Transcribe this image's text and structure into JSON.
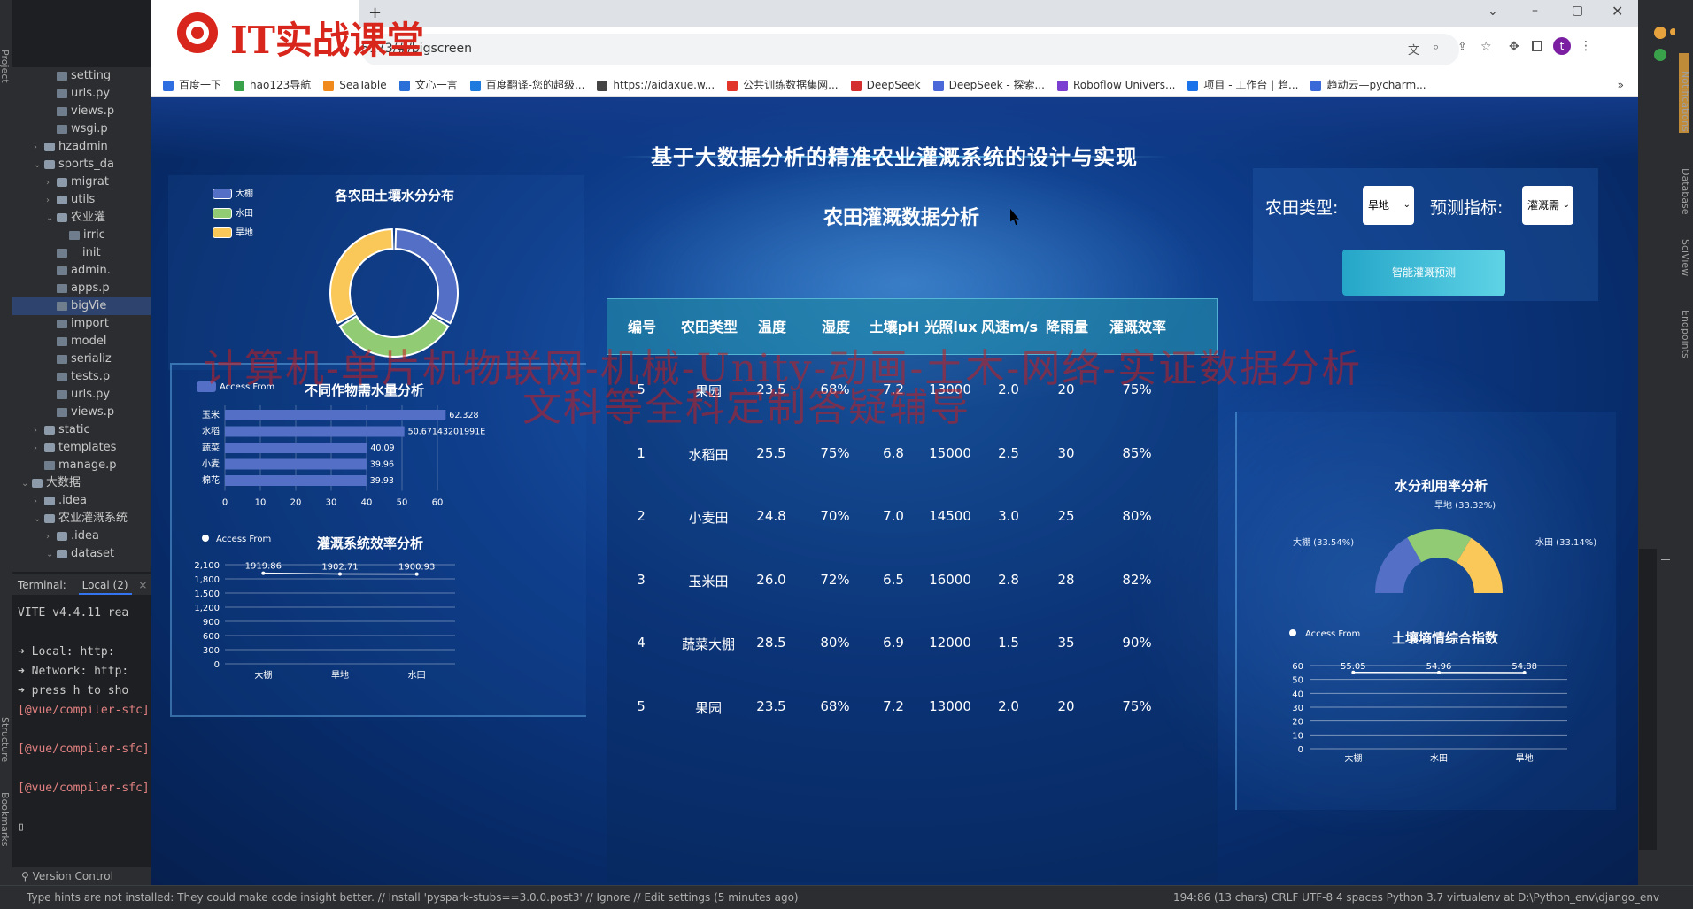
{
  "ide": {
    "tree": [
      {
        "indent": 3,
        "type": "file",
        "label": "setting"
      },
      {
        "indent": 3,
        "type": "file",
        "label": "urls.py"
      },
      {
        "indent": 3,
        "type": "file",
        "label": "views.p"
      },
      {
        "indent": 3,
        "type": "file",
        "label": "wsgi.p"
      },
      {
        "indent": 2,
        "type": "folder",
        "tw": "›",
        "label": "hzadmin"
      },
      {
        "indent": 2,
        "type": "folder",
        "tw": "⌄",
        "label": "sports_da"
      },
      {
        "indent": 3,
        "type": "folder",
        "tw": "›",
        "label": "migrat"
      },
      {
        "indent": 3,
        "type": "folder",
        "tw": "›",
        "label": "utils"
      },
      {
        "indent": 3,
        "type": "folder",
        "tw": "⌄",
        "label": "农业灌"
      },
      {
        "indent": 4,
        "type": "file",
        "label": "irric"
      },
      {
        "indent": 3,
        "type": "file",
        "label": "__init__"
      },
      {
        "indent": 3,
        "type": "file",
        "label": "admin."
      },
      {
        "indent": 3,
        "type": "file",
        "label": "apps.p"
      },
      {
        "indent": 3,
        "type": "file",
        "label": "bigVie",
        "selected": true
      },
      {
        "indent": 3,
        "type": "file",
        "label": "import"
      },
      {
        "indent": 3,
        "type": "file",
        "label": "model"
      },
      {
        "indent": 3,
        "type": "file",
        "label": "serializ"
      },
      {
        "indent": 3,
        "type": "file",
        "label": "tests.p"
      },
      {
        "indent": 3,
        "type": "file",
        "label": "urls.py"
      },
      {
        "indent": 3,
        "type": "file",
        "label": "views.p"
      },
      {
        "indent": 2,
        "type": "folder",
        "tw": "›",
        "label": "static"
      },
      {
        "indent": 2,
        "type": "folder",
        "tw": "›",
        "label": "templates"
      },
      {
        "indent": 2,
        "type": "file",
        "label": "manage.p"
      },
      {
        "indent": 1,
        "type": "folder",
        "tw": "⌄",
        "label": "大数据"
      },
      {
        "indent": 2,
        "type": "folder",
        "tw": "›",
        "label": ".idea"
      },
      {
        "indent": 2,
        "type": "folder",
        "tw": "⌄",
        "label": "农业灌溉系统"
      },
      {
        "indent": 3,
        "type": "folder",
        "tw": "›",
        "label": ".idea"
      },
      {
        "indent": 3,
        "type": "folder",
        "tw": "⌄",
        "label": "dataset"
      }
    ],
    "terminal_label": "Terminal:",
    "terminal_tab": "Local (2)",
    "terminal_lines": [
      "VITE v4.4.11  rea",
      "",
      "➜  Local:   http:",
      "➜  Network: http:",
      "➜  press h to sho",
      "[@vue/compiler-sfc]",
      "",
      "[@vue/compiler-sfc]",
      "",
      "[@vue/compiler-sfc]",
      "",
      "▯"
    ],
    "version_control": "Version Control",
    "status_left": "Type hints are not installed: They could make code insight better. // Install 'pyspark-stubs==3.0.0.post3' // Ignore // Edit settings (5 minutes ago)",
    "status_right": "194:86 (13 chars)   CRLF   UTF-8   4 spaces   Python 3.7 virtualenv at D:\\Python_env\\django_env",
    "left_vertical": [
      "Project",
      "Structure",
      "Bookmarks"
    ],
    "right_vertical": [
      "Notifications",
      "Database",
      "SciView",
      "Endpoints"
    ]
  },
  "browser": {
    "logo_text": "IT实战课堂",
    "new_tab": "+",
    "url": "5173/#/bigscreen",
    "bookmarks": [
      "百度一下",
      "hao123导航",
      "SeaTable",
      "文心一言",
      "百度翻译-您的超级...",
      "https://aidaxue.w...",
      "公共训练数据集网...",
      "DeepSeek",
      "DeepSeek - 探索...",
      "Roboflow Univers...",
      "项目 - 工作台 | 趋...",
      "趋动云—pycharm..."
    ],
    "bookmark_colors": [
      "#2f6ee0",
      "#3aa14b",
      "#f08a1c",
      "#2b6fd8",
      "#1f7ae0",
      "#444",
      "#e2352a",
      "#d32f2f",
      "#4a68d8",
      "#7a3fd0",
      "#1a73e8",
      "#3a6ad8"
    ],
    "more": "»",
    "avatar": "t"
  },
  "dashboard": {
    "title": "基于大数据分析的精准农业灌溉系统的设计与实现",
    "soil_chart": {
      "title": "各农田土壤水分分布",
      "legend": [
        "大棚",
        "水田",
        "旱地"
      ],
      "colors": [
        "#5470c6",
        "#91cc75",
        "#fac858"
      ]
    },
    "crop_chart": {
      "title": "不同作物需水量分析",
      "legend": "Access From"
    },
    "efficiency_chart": {
      "title": "灌溉系统效率分析",
      "legend": "Access From"
    },
    "table": {
      "title": "农田灌溉数据分析",
      "headers": [
        "编号",
        "农田类型",
        "温度",
        "湿度",
        "土壤pH",
        "光照lux",
        "风速m/s",
        "降雨量",
        "灌溉效率"
      ],
      "rows": [
        [
          "5",
          "果园",
          "23.5",
          "68%",
          "7.2",
          "13000",
          "2.0",
          "20",
          "75%"
        ],
        [
          "1",
          "水稻田",
          "25.5",
          "75%",
          "6.8",
          "15000",
          "2.5",
          "30",
          "85%"
        ],
        [
          "2",
          "小麦田",
          "24.8",
          "70%",
          "7.0",
          "14500",
          "3.0",
          "25",
          "80%"
        ],
        [
          "3",
          "玉米田",
          "26.0",
          "72%",
          "6.5",
          "16000",
          "2.8",
          "28",
          "82%"
        ],
        [
          "4",
          "蔬菜大棚",
          "28.5",
          "80%",
          "6.9",
          "12000",
          "1.5",
          "35",
          "90%"
        ],
        [
          "5",
          "果园",
          "23.5",
          "68%",
          "7.2",
          "13000",
          "2.0",
          "20",
          "75%"
        ]
      ]
    },
    "controls": {
      "field_label": "农田类型:",
      "field_value": "旱地",
      "metric_label": "预测指标:",
      "metric_value": "灌溉需",
      "button": "智能灌溉预测"
    },
    "water_chart": {
      "title": "水分利用率分析",
      "labels": [
        "旱地 (33.32%)",
        "大棚 (33.54%)",
        "水田 (33.14%)"
      ]
    },
    "soil_index_chart": {
      "title": "土壤墒情综合指数",
      "legend": "Access From"
    },
    "watermark": [
      "计算机-单片机物联网-机械-Unity-动画-土木-网络-实证数据分析",
      "文科等全科定制答疑辅导"
    ]
  },
  "chart_data": [
    {
      "type": "pie",
      "title": "各农田土壤水分分布",
      "categories": [
        "大棚",
        "水田",
        "旱地"
      ],
      "values": [
        33.33,
        33.33,
        33.34
      ],
      "legend_placement": "top-left"
    },
    {
      "type": "bar",
      "title": "不同作物需水量分析",
      "orientation": "horizontal",
      "categories": [
        "玉米",
        "水稻",
        "蔬菜",
        "小麦",
        "棉花"
      ],
      "values": [
        62.328,
        50.6714320199,
        40.09,
        39.96,
        39.93
      ],
      "value_labels": [
        "62.328",
        "50.67143201991E",
        "40.09",
        "39.96",
        "39.93"
      ],
      "xlim": [
        0,
        60
      ],
      "xticks": [
        "0",
        "10",
        "20",
        "30",
        "40",
        "50",
        "60"
      ],
      "series": [
        {
          "name": "Access From",
          "values": [
            62.328,
            50.6714320199,
            40.09,
            39.96,
            39.93
          ]
        }
      ]
    },
    {
      "type": "line",
      "title": "灌溉系统效率分析",
      "categories": [
        "大棚",
        "旱地",
        "水田"
      ],
      "values": [
        1919.86,
        1902.71,
        1900.93
      ],
      "value_labels": [
        "1919.86",
        "1902.71",
        "1900.93"
      ],
      "ylim": [
        0,
        2100
      ],
      "yticks": [
        "0",
        "300",
        "600",
        "900",
        "1,200",
        "1,500",
        "1,800",
        "2,100"
      ],
      "series": [
        {
          "name": "Access From",
          "values": [
            1919.86,
            1902.71,
            1900.93
          ]
        }
      ]
    },
    {
      "type": "pie",
      "title": "水分利用率分析",
      "categories": [
        "旱地",
        "大棚",
        "水田"
      ],
      "values": [
        33.32,
        33.54,
        33.14
      ],
      "colors": [
        "#91cc75",
        "#5470c6",
        "#fac858"
      ]
    },
    {
      "type": "line",
      "title": "土壤墒情综合指数",
      "categories": [
        "大棚",
        "水田",
        "旱地"
      ],
      "values": [
        55.05,
        54.96,
        54.88
      ],
      "value_labels": [
        "55.05",
        "54.96",
        "54.88"
      ],
      "ylim": [
        0,
        60
      ],
      "yticks": [
        "0",
        "10",
        "20",
        "30",
        "40",
        "50",
        "60"
      ],
      "series": [
        {
          "name": "Access From",
          "values": [
            55.05,
            54.96,
            54.88
          ]
        }
      ]
    }
  ]
}
